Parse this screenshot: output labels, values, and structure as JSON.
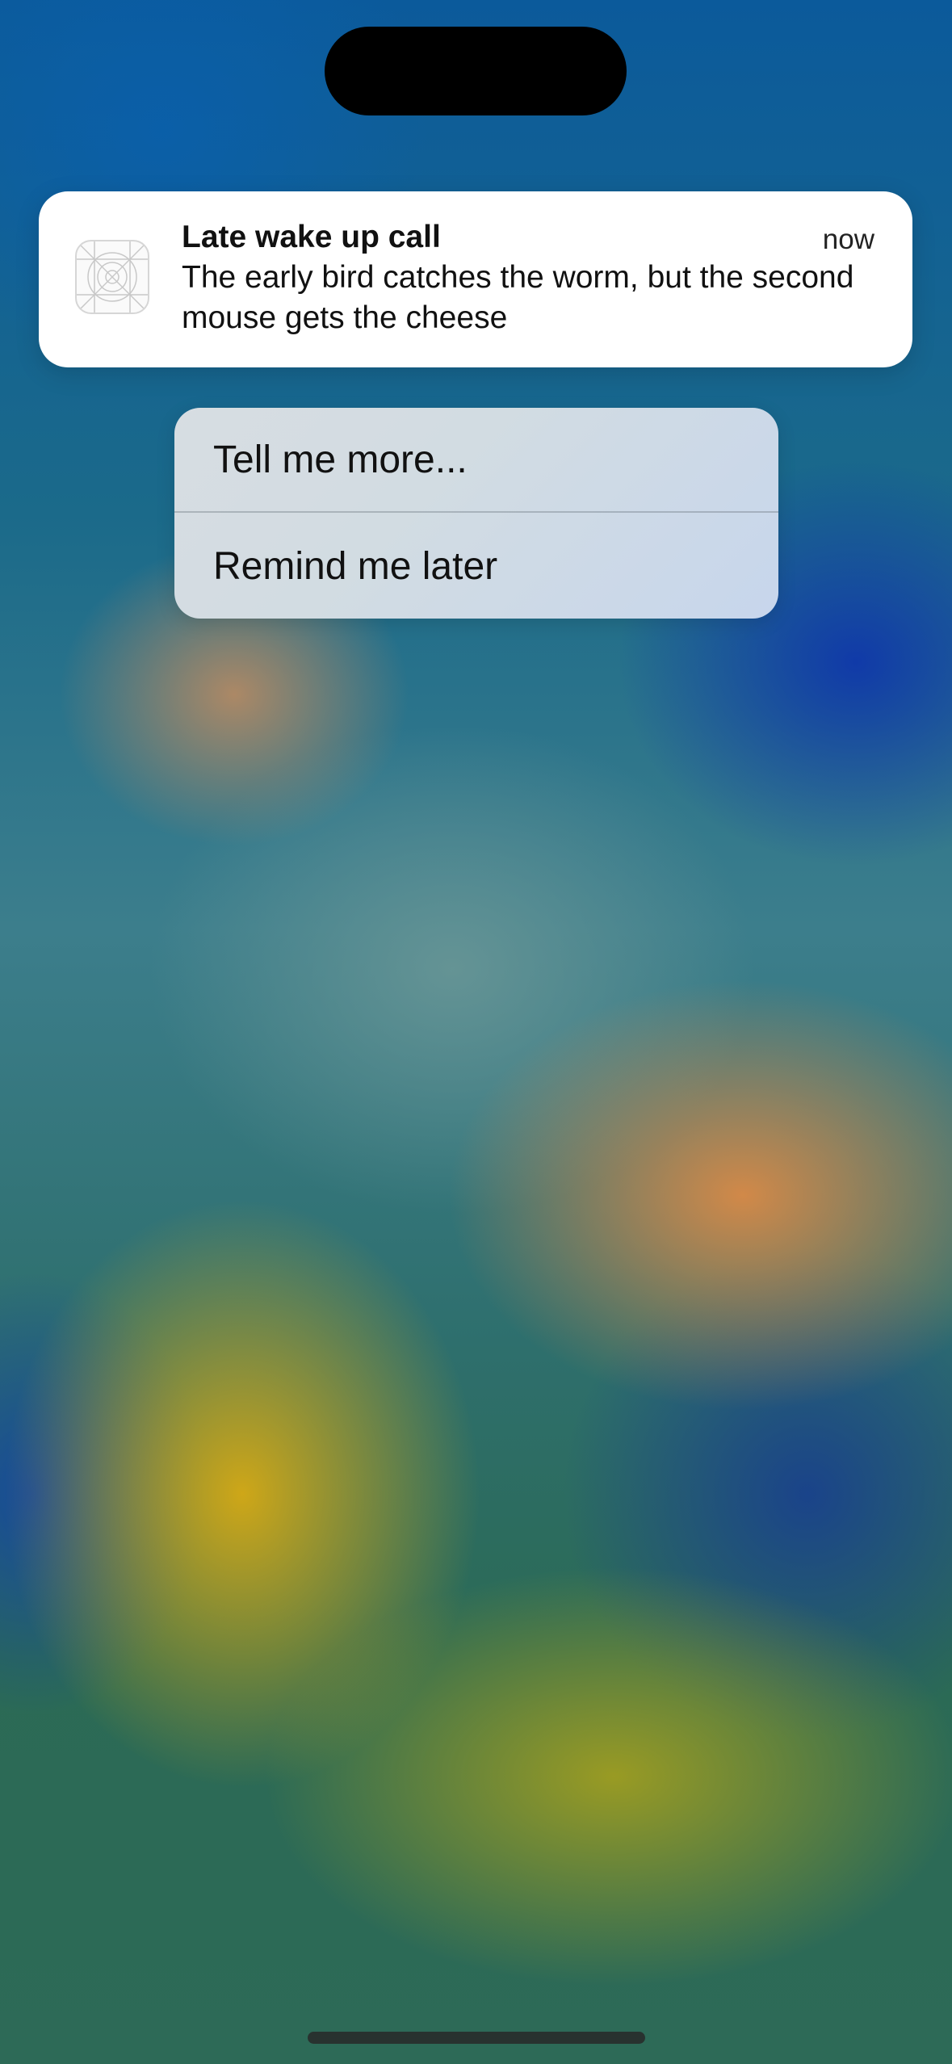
{
  "notification": {
    "title": "Late wake up call",
    "body": "The early bird catches the worm, but the second mouse gets the cheese",
    "time": "now",
    "app_icon": "app-placeholder-icon"
  },
  "actions": [
    {
      "label": "Tell me more..."
    },
    {
      "label": "Remind me later"
    }
  ]
}
